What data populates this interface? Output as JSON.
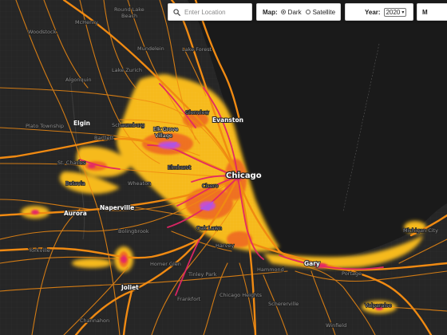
{
  "controls": {
    "search": {
      "placeholder": "Enter Location",
      "icon": "search-icon"
    },
    "map_type": {
      "label": "Map:",
      "options": [
        {
          "label": "Dark",
          "selected": true
        },
        {
          "label": "Satellite",
          "selected": false
        }
      ]
    },
    "year": {
      "label": "Year:",
      "selected": "2020"
    },
    "extra_label": "M"
  },
  "places": {
    "chicago": "Chicago",
    "evanston": "Evanston",
    "elgin": "Elgin",
    "aurora": "Aurora",
    "naperville": "Naperville",
    "joliet": "Joliet",
    "gary": "Gary",
    "schaumburg": "Schaumburg",
    "elk_grove_1": "Elk Grove",
    "elk_grove_2": "Village",
    "round_lake_1": "Round Lake",
    "round_lake_2": "Beach",
    "woodstock": "Woodstock",
    "mchenry": "McHenry",
    "mundelein": "Mundelein",
    "lake_forest": "Lake Forest",
    "lake_zurich": "Lake Zurich",
    "algonquin": "Algonquin",
    "plato_township": "Plato Township",
    "bartlett": "Bartlett",
    "st_charles": "St. Charles",
    "batavia": "Batavia",
    "bolingbrook": "Bolingbrook",
    "yorkville": "Yorkville",
    "homer_glen": "Homer Glen",
    "tinley_park": "Tinley Park",
    "frankfort": "Frankfort",
    "oak_lawn": "Oak Lawn",
    "harvey": "Harvey",
    "hammond": "Hammond",
    "chicago_heights": "Chicago Heights",
    "schererville": "Schererville",
    "portage": "Portage",
    "valparaiso": "Valparaiso",
    "michigan_city": "Michigan City",
    "channahon": "Channahon",
    "winfield": "Winfield",
    "glenview": "Glenview",
    "elmhurst": "Elmhurst",
    "cicero": "Cicero",
    "wheaton": "Wheaton"
  },
  "colors": {
    "background": "#242424",
    "water": "#1a1a1a",
    "road": "#f08a12",
    "heat_low": "#f5b81c",
    "heat_mid": "#ef6a22",
    "heat_high": "#e32567",
    "heat_peak": "#c94fc9"
  }
}
